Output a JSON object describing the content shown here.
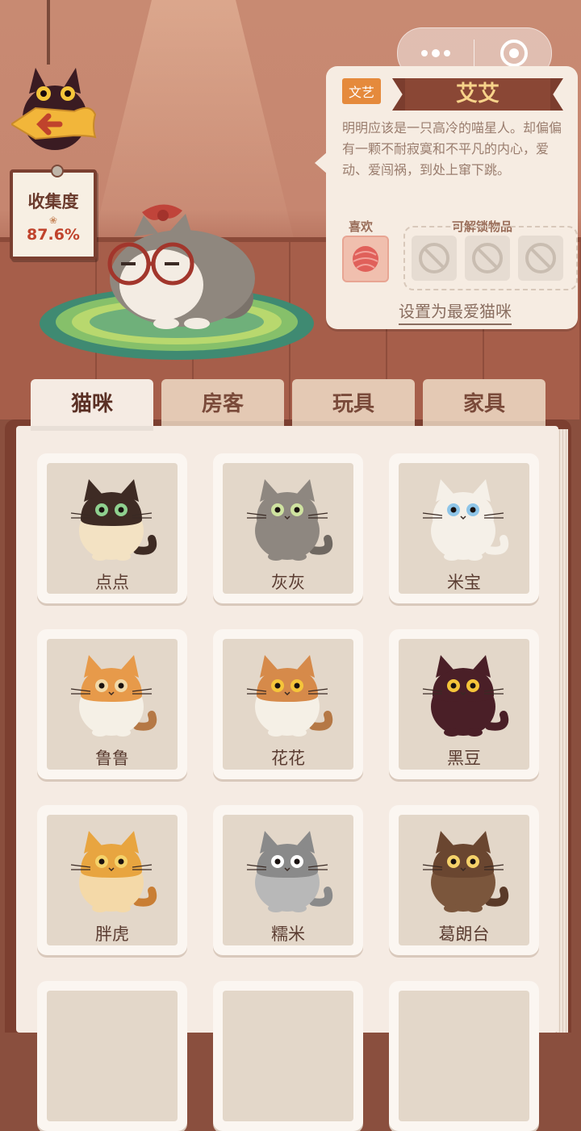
{
  "collection": {
    "label": "收集度",
    "value": "87.6%"
  },
  "cat_detail": {
    "tag": "文艺",
    "name": "艾艾",
    "description": "明明应该是一只高冷的喵星人。却偏偏有一颗不耐寂寞和不平凡的内心，爱动、爱闯祸，到处上窜下跳。",
    "likes_label": "喜欢",
    "unlock_label": "可解锁物品",
    "set_favorite_label": "设置为最爱猫咪"
  },
  "tabs": [
    {
      "label": "猫咪",
      "active": true
    },
    {
      "label": "房客",
      "active": false
    },
    {
      "label": "玩具",
      "active": false
    },
    {
      "label": "家具",
      "active": false
    }
  ],
  "cats": [
    {
      "name": "点点",
      "body": "#f3e2c3",
      "head": "#3e2b24",
      "eyes": "#8fd08f",
      "tail": "#3e2b24"
    },
    {
      "name": "灰灰",
      "body": "#8e8780",
      "head": "#8e8780",
      "eyes": "#cfe3a0",
      "tail": "#6f6861"
    },
    {
      "name": "米宝",
      "body": "#f5f0e8",
      "head": "#f5f0e8",
      "eyes": "#8ec5e8",
      "tail": "#f5f0e8"
    },
    {
      "name": "鲁鲁",
      "body": "#f5f0e6",
      "head": "#e79a4a",
      "eyes": "#f2d9a8",
      "tail": "#b57845"
    },
    {
      "name": "花花",
      "body": "#f5f0e6",
      "head": "#d68a4a",
      "eyes": "#f5c53a",
      "tail": "#b57845"
    },
    {
      "name": "黑豆",
      "body": "#4a1f27",
      "head": "#4a1f27",
      "eyes": "#f5c53a",
      "tail": "#4a1f27"
    },
    {
      "name": "胖虎",
      "body": "#f4d9a8",
      "head": "#e8a540",
      "eyes": "#f5d26a",
      "tail": "#c97e34"
    },
    {
      "name": "糯米",
      "body": "#b8b8b8",
      "head": "#8a8a8a",
      "eyes": "#ffffff",
      "tail": "#8a8a8a"
    },
    {
      "name": "葛朗台",
      "body": "#7b563c",
      "head": "#6a4630",
      "eyes": "#f5d26a",
      "tail": "#5a3a28"
    }
  ]
}
